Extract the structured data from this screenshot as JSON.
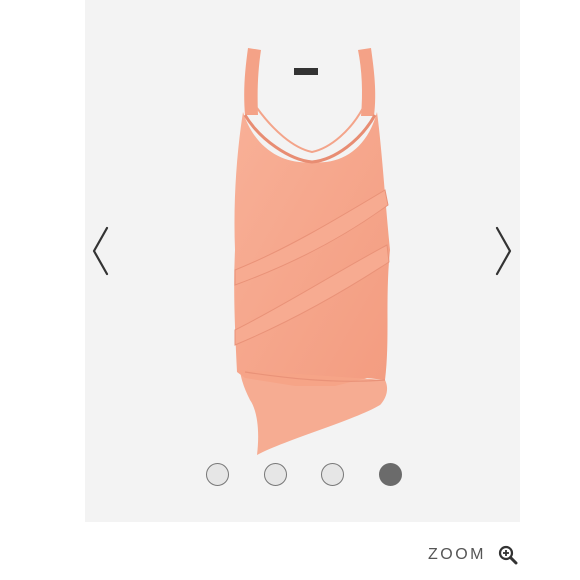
{
  "gallery": {
    "background_color": "#f3f3f3",
    "product_color": "#f6a68a",
    "dots": [
      {
        "state": "inactive"
      },
      {
        "state": "inactive"
      },
      {
        "state": "inactive"
      },
      {
        "state": "active"
      }
    ],
    "active_index": 3,
    "prev_icon": "chevron-left-icon",
    "next_icon": "chevron-right-icon"
  },
  "zoom": {
    "label": "ZOOM",
    "icon": "zoom-in-icon"
  }
}
